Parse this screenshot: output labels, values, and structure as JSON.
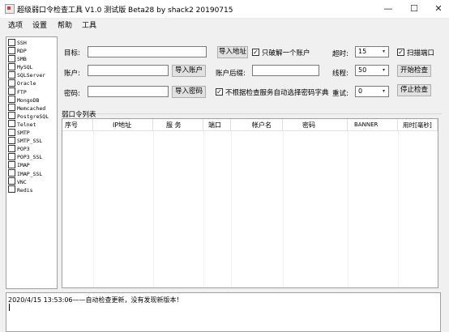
{
  "window": {
    "title": "超级弱口令检查工具 V1.0 测试版 Beta28 by shack2 20190715",
    "app_icon": "app-icon",
    "minimize": "—",
    "maximize": "☐",
    "close": "✕"
  },
  "menu": [
    "选项",
    "设置",
    "帮助",
    "工具"
  ],
  "protocols": [
    "SSH",
    "RDP",
    "SMB",
    "MySQL",
    "SQLServer",
    "Oracle",
    "FTP",
    "MongoDB",
    "Memcached",
    "PostgreSQL",
    "Telnet",
    "SMTP",
    "SMTP_SSL",
    "POP3",
    "POP3_SSL",
    "IMAP",
    "IMAP_SSL",
    "VNC",
    "Redis"
  ],
  "form": {
    "target_label": "目标:",
    "target_value": "",
    "import_address": "导入地址",
    "crack_one_label": "只破解一个账户",
    "crack_one_checked": true,
    "account_label": "账户:",
    "account_value": "",
    "import_account": "导入账户",
    "account_suffix_label": "账户后缀:",
    "account_suffix_value": "",
    "password_label": "密码:",
    "password_value": "",
    "import_password": "导入密码",
    "no_auto_dict_label": "不根据检查服务自动选择密码字典",
    "no_auto_dict_checked": true,
    "timeout_label": "超时:",
    "timeout_value": "15",
    "threads_label": "线程:",
    "threads_value": "50",
    "retry_label": "重试:",
    "retry_value": "0",
    "scan_port_label": "扫描端口",
    "scan_port_checked": true,
    "start_check": "开始检查",
    "stop_check": "停止检查"
  },
  "list": {
    "group_title": "弱口令列表",
    "columns": [
      "序号",
      "IP地址",
      "服 务",
      "端口",
      "帐户名",
      "密码",
      "BANNER",
      "用时[毫秒]"
    ]
  },
  "log": {
    "line": "2020/4/15 13:53:06——自动检查更新，没有发现新版本！"
  },
  "icons": {
    "combo_arrow": "▾",
    "check_mark": "✓"
  }
}
